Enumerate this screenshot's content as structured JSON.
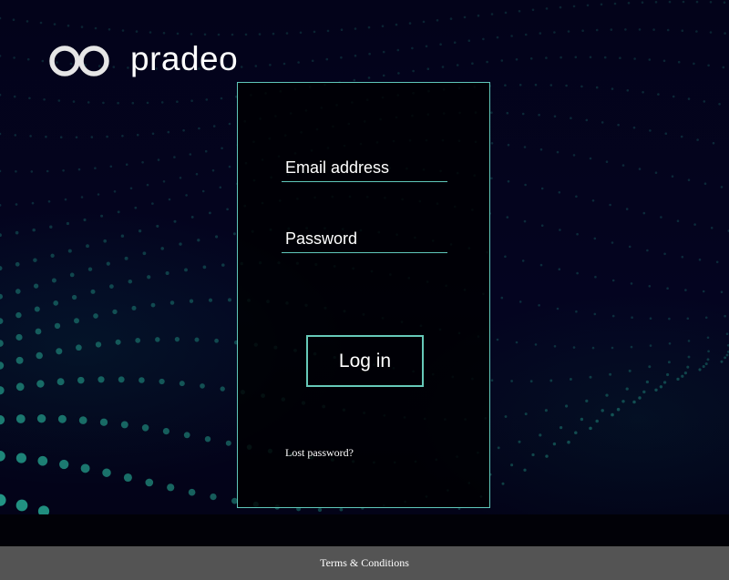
{
  "brand": {
    "name": "pradeo",
    "logo_icon": "infinity-rings-icon"
  },
  "login_form": {
    "email_placeholder": "Email address",
    "password_placeholder": "Password",
    "submit_label": "Log in",
    "lost_password_label": "Lost password?"
  },
  "footer": {
    "terms_label": "Terms & Conditions"
  },
  "colors": {
    "accent": "#5fc7bb",
    "background": "#03031a",
    "footer": "#545454",
    "dots": "#2bbfa3"
  }
}
